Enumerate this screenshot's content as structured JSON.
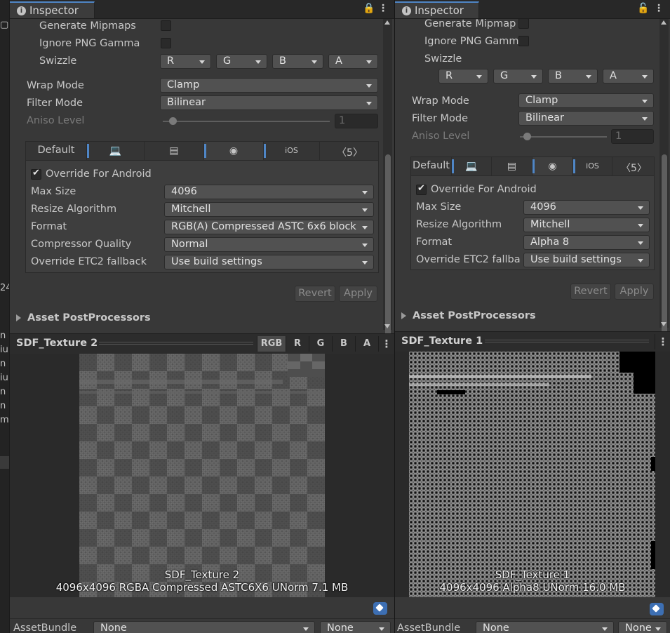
{
  "left_strip": {
    "top_glyph": "▢",
    "partial_number": "24",
    "partial_rows": [
      "n",
      "iu",
      "n",
      "iu",
      "n",
      "n",
      "m"
    ]
  },
  "panels": [
    {
      "id": "left",
      "tab": {
        "title": "Inspector"
      },
      "settings": {
        "generate_mipmaps": "Generate Mipmaps",
        "ignore_png_gamma": "Ignore PNG Gamma",
        "swizzle": "Swizzle",
        "swizzle_values": [
          "R",
          "G",
          "B",
          "A"
        ],
        "wrap_mode_label": "Wrap Mode",
        "wrap_mode_value": "Clamp",
        "filter_mode_label": "Filter Mode",
        "filter_mode_value": "Bilinear",
        "aniso_label": "Aniso Level",
        "aniso_value": "1"
      },
      "platform_tabs": {
        "default": "Default",
        "ios": "iOS"
      },
      "platform": {
        "override_label": "Override For Android",
        "override_checked": true,
        "rows": [
          {
            "label": "Max Size",
            "value": "4096"
          },
          {
            "label": "Resize Algorithm",
            "value": "Mitchell"
          },
          {
            "label": "Format",
            "value": "RGB(A) Compressed ASTC 6x6 block"
          },
          {
            "label": "Compressor Quality",
            "value": "Normal"
          },
          {
            "label": "Override ETC2 fallback",
            "value": "Use build settings"
          }
        ]
      },
      "buttons": {
        "revert": "Revert",
        "apply": "Apply"
      },
      "foldout": "Asset PostProcessors",
      "preview": {
        "title": "SDF_Texture 2",
        "channels": [
          "RGB",
          "R",
          "G",
          "B",
          "A"
        ],
        "caption_name": "SDF_Texture 2",
        "caption_info": "4096x4096  RGBA Compressed ASTC6X6 UNorm   7.1 MB"
      },
      "asset_bundle": {
        "label": "AssetBundle",
        "value": "None",
        "variant": "None"
      }
    },
    {
      "id": "right",
      "tab": {
        "title": "Inspector"
      },
      "settings": {
        "generate_mipmaps": "Generate Mipmap",
        "ignore_png_gamma": "Ignore PNG Gamm",
        "swizzle": "Swizzle",
        "swizzle_values": [
          "R",
          "G",
          "B",
          "A"
        ],
        "wrap_mode_label": "Wrap Mode",
        "wrap_mode_value": "Clamp",
        "filter_mode_label": "Filter Mode",
        "filter_mode_value": "Bilinear",
        "aniso_label": "Aniso Level",
        "aniso_value": "1"
      },
      "platform_tabs": {
        "default": "Default",
        "ios": "iOS"
      },
      "platform": {
        "override_label": "Override For Android",
        "override_checked": true,
        "rows": [
          {
            "label": "Max Size",
            "value": "4096"
          },
          {
            "label": "Resize Algorithm",
            "value": "Mitchell"
          },
          {
            "label": "Format",
            "value": "Alpha 8"
          },
          {
            "label": "Override ETC2 fallba",
            "value": "Use build settings"
          }
        ]
      },
      "buttons": {
        "revert": "Revert",
        "apply": "Apply"
      },
      "foldout": "Asset PostProcessors",
      "preview": {
        "title": "SDF_Texture 1",
        "caption_name": "SDF_Texture 1",
        "caption_info": "4096x4096  Alpha8 UNorm   16.0 MB"
      },
      "asset_bundle": {
        "label": "AssetBundle",
        "value": "None",
        "variant": "None"
      }
    }
  ],
  "colors": {
    "tab_accent": "#4f86c6",
    "panel_bg": "#383838",
    "field_bg": "#515151",
    "tag_icon": "#3d6fb3"
  }
}
